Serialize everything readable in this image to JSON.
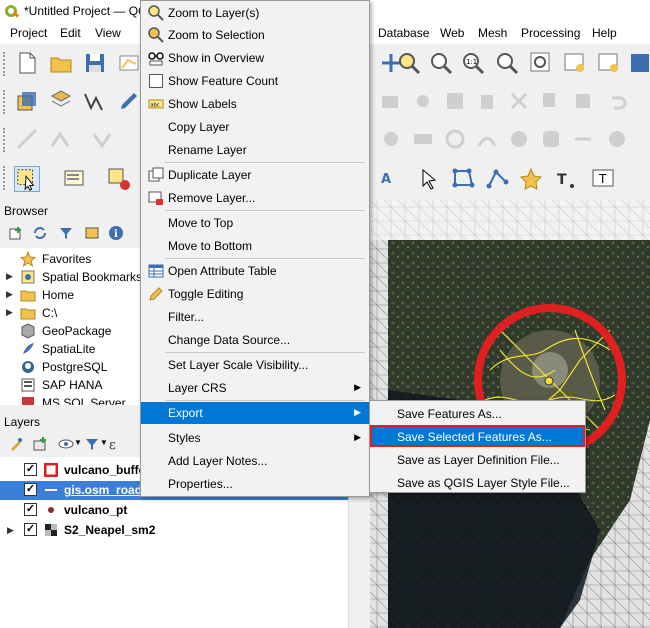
{
  "window": {
    "title": "*Untitled Project — QGIS"
  },
  "menubar": {
    "items": [
      "Project",
      "Edit",
      "View",
      "Database",
      "Web",
      "Mesh",
      "Processing",
      "Help"
    ]
  },
  "browser": {
    "title": "Browser",
    "items": [
      {
        "label": "Favorites",
        "icon": "star-icon"
      },
      {
        "label": "Spatial Bookmarks",
        "icon": "bookmark-icon"
      },
      {
        "label": "Home",
        "icon": "folder-icon"
      },
      {
        "label": "C:\\",
        "icon": "folder-icon"
      },
      {
        "label": "GeoPackage",
        "icon": "geopackage-icon"
      },
      {
        "label": "SpatiaLite",
        "icon": "spatialite-icon"
      },
      {
        "label": "PostgreSQL",
        "icon": "postgresql-icon"
      },
      {
        "label": "SAP HANA",
        "icon": "saphana-icon"
      },
      {
        "label": "MS SQL Server",
        "icon": "mssql-icon"
      }
    ]
  },
  "layers": {
    "title": "Layers",
    "items": [
      {
        "name": "vulcano_buffer",
        "checked": "✓",
        "icon": "polygon-layer-icon"
      },
      {
        "name": "gis.osm_roads",
        "checked": "✓",
        "icon": "line-layer-icon"
      },
      {
        "name": "vulcano_pt",
        "checked": "✓",
        "icon": "point-layer-icon"
      },
      {
        "name": "S2_Neapel_sm2",
        "checked": "✓",
        "icon": "raster-layer-icon"
      }
    ]
  },
  "context_menu": {
    "items": [
      {
        "label": "Zoom to Layer(s)",
        "icon": "zoom-layer-icon"
      },
      {
        "label": "Zoom to Selection",
        "icon": "zoom-selection-icon"
      },
      {
        "label": "Show in Overview",
        "icon": "overview-icon"
      },
      {
        "label": "Show Feature Count",
        "icon": "checkbox-icon"
      },
      {
        "label": "Show Labels",
        "icon": "labels-icon"
      },
      {
        "label": "Copy Layer",
        "icon": ""
      },
      {
        "label": "Rename Layer",
        "icon": ""
      },
      {
        "label": "Duplicate Layer",
        "icon": "duplicate-icon"
      },
      {
        "label": "Remove Layer...",
        "icon": "remove-icon"
      },
      {
        "label": "Move to Top",
        "icon": ""
      },
      {
        "label": "Move to Bottom",
        "icon": ""
      },
      {
        "label": "Open Attribute Table",
        "icon": "table-icon"
      },
      {
        "label": "Toggle Editing",
        "icon": "pencil-icon"
      },
      {
        "label": "Filter...",
        "icon": ""
      },
      {
        "label": "Change Data Source...",
        "icon": ""
      },
      {
        "label": "Set Layer Scale Visibility...",
        "icon": ""
      },
      {
        "label": "Layer CRS",
        "icon": ""
      },
      {
        "label": "Export",
        "icon": ""
      },
      {
        "label": "Styles",
        "icon": ""
      },
      {
        "label": "Add Layer Notes...",
        "icon": ""
      },
      {
        "label": "Properties...",
        "icon": ""
      }
    ]
  },
  "export_submenu": {
    "items": [
      {
        "label": "Save Features As..."
      },
      {
        "label": "Save Selected Features As..."
      },
      {
        "label": "Save as Layer Definition File..."
      },
      {
        "label": "Save as QGIS Layer Style File..."
      }
    ]
  }
}
